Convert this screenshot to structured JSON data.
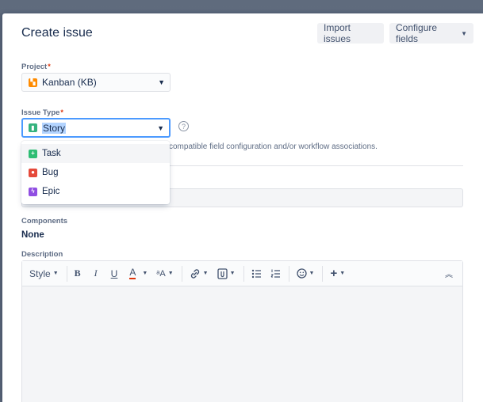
{
  "modal": {
    "title": "Create issue",
    "import_label": "Import issues",
    "configure_label": "Configure fields"
  },
  "project": {
    "label": "Project",
    "value": "Kanban (KB)",
    "icon": "kanban-project-icon"
  },
  "issue_type": {
    "label": "Issue Type",
    "value": "Story",
    "icon": "story-icon",
    "hint": "compatible field configuration and/or workflow associations.",
    "options": [
      {
        "label": "Task",
        "icon": "task-icon",
        "color": "#2ebd74"
      },
      {
        "label": "Bug",
        "icon": "bug-icon",
        "color": "#e5493a"
      },
      {
        "label": "Epic",
        "icon": "epic-icon",
        "color": "#904ee2"
      }
    ]
  },
  "components": {
    "label": "Components",
    "value": "None"
  },
  "description": {
    "label": "Description",
    "toolbar": {
      "style_label": "Style",
      "bold": "B",
      "italic": "I",
      "underline": "U",
      "text_color": "A"
    }
  },
  "colors": {
    "accent": "#4c9aff",
    "required": "#de350b"
  }
}
